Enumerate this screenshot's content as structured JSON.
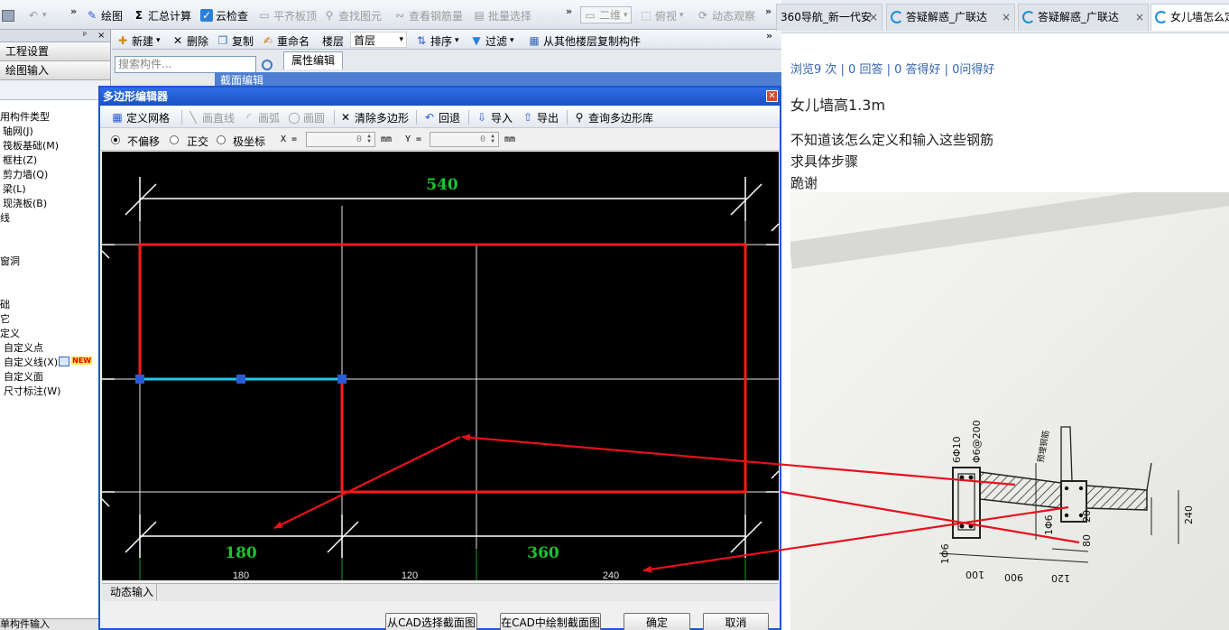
{
  "toolbar_top": {
    "draw": "绘图",
    "summary": "汇总计算",
    "cloud_check": "云检查",
    "flush_slab": "平齐板顶",
    "find_element": "查找图元",
    "view_rebar": "查看钢筋量",
    "batch_select": "批量选择",
    "view_mode": "二维",
    "view_angle": "俯视",
    "dynamic_view": "动态观察"
  },
  "left_panel": {
    "header_pin": "ᵖ",
    "header_close": "×",
    "project_settings": "工程设置",
    "drawing_input": "绘图输入",
    "items": [
      {
        "text": "用构件类型"
      },
      {
        "text": "轴网(J)"
      },
      {
        "text": "筏板基础(M)"
      },
      {
        "text": "框柱(Z)"
      },
      {
        "text": "剪力墙(Q)"
      },
      {
        "text": "梁(L)"
      },
      {
        "text": "现浇板(B)"
      },
      {
        "text": "线"
      },
      {
        "text": "窗洞"
      },
      {
        "text": "础"
      },
      {
        "text": "它"
      },
      {
        "text": "定义"
      },
      {
        "text": "自定义点"
      },
      {
        "text": "自定义线(X)"
      },
      {
        "text": "自定义面"
      },
      {
        "text": "尺寸标注(W)"
      }
    ],
    "new_badge": "NEW",
    "bottom": "单构件输入"
  },
  "toolbar_2": {
    "new": "新建",
    "delete": "删除",
    "copy": "复制",
    "rename": "重命名",
    "floor_label": "楼层",
    "floor_value": "首层",
    "sort": "排序",
    "filter": "过滤",
    "copy_from_floor": "从其他楼层复制构件"
  },
  "search": {
    "placeholder": "搜索构件..."
  },
  "property_tab": "属性编辑",
  "section_editor_title": "截面编辑",
  "dialog": {
    "title": "多边形编辑器",
    "toolbar": {
      "define_grid": "定义网格",
      "draw_line": "画直线",
      "draw_arc": "画弧",
      "draw_circle": "画圆",
      "clear_polygon": "清除多边形",
      "undo": "回退",
      "import": "导入",
      "export": "导出",
      "query_library": "查询多边形库"
    },
    "options": {
      "no_offset": "不偏移",
      "ortho": "正交",
      "polar": "极坐标",
      "x_label": "X =",
      "x_value": "0",
      "y_label": "Y =",
      "y_value": "0",
      "unit": "mm"
    },
    "status_tab": "动态输入",
    "buttons": {
      "select_from_cad": "从CAD选择截面图",
      "draw_in_cad": "在CAD中绘制截面图",
      "ok": "确定",
      "cancel": "取消"
    }
  },
  "drawing": {
    "dim_top": "540",
    "dim_bottom_left": "180",
    "dim_bottom_right": "360",
    "grid_labels": [
      "180",
      "120",
      "240"
    ],
    "colors": {
      "outline": "#ff1a1a",
      "highlight": "#22c8e8",
      "dimension": "#18c530",
      "grid": "#e6e6e6",
      "node": "#2a5bd7"
    }
  },
  "browser": {
    "tabs": [
      {
        "title": "360导航_新一代安",
        "close": "×"
      },
      {
        "title": "答疑解惑_广联达",
        "close": "×"
      },
      {
        "title": "答疑解惑_广联达",
        "close": "×"
      },
      {
        "title": "女儿墙怎么定",
        "close": ""
      }
    ],
    "stats": "浏览9 次 | 0 回答 | 0 答得好 | 0问得好",
    "question_title": "女儿墙高1.3m",
    "question_lines": [
      "不知道该怎么定义和输入这些钢筋",
      "求具体步骤",
      "跪谢"
    ]
  },
  "photo": {
    "labels": [
      "6Φ10",
      "Φ6@200",
      "1Φ6",
      "80",
      "20",
      "1Φ6",
      "100",
      "120",
      "900",
      "120",
      "240",
      "预埋钢筋"
    ]
  }
}
